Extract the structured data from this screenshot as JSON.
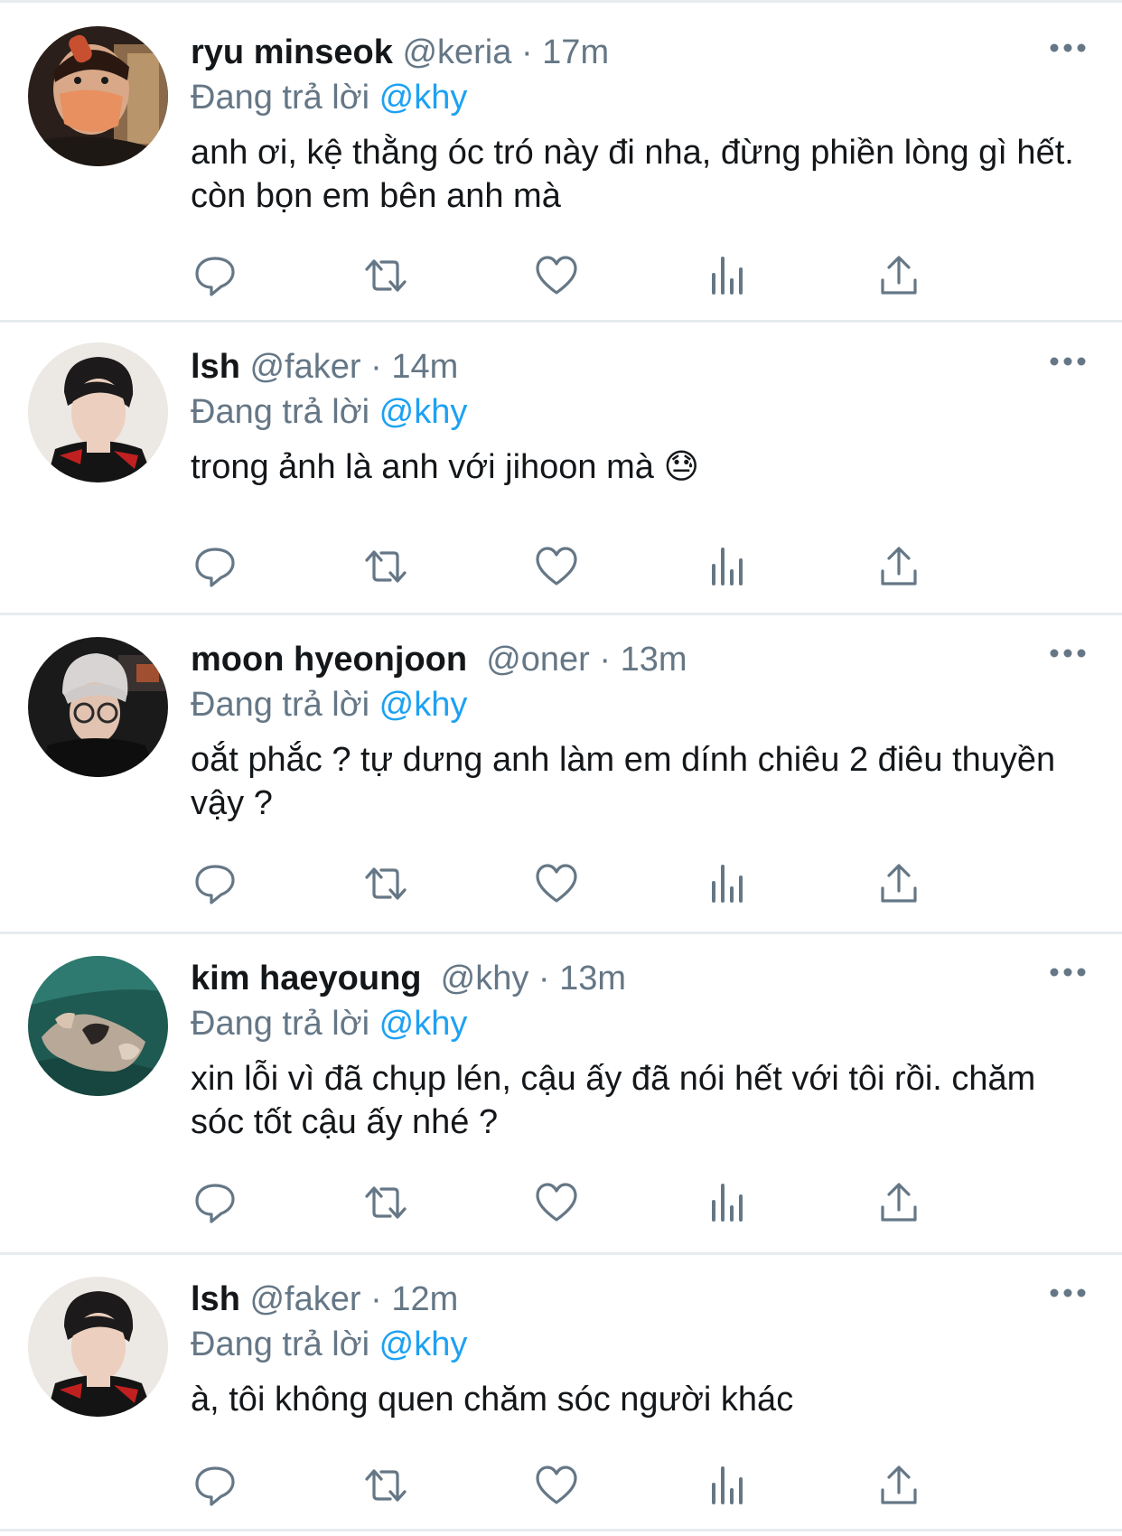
{
  "icons": {
    "more": "more-horizontal-icon",
    "reply": "reply-icon",
    "retweet": "retweet-icon",
    "like": "heart-icon",
    "views": "views-icon",
    "share": "share-icon"
  },
  "colors": {
    "text": "#14171a",
    "secondary": "#657786",
    "accent": "#1da1f2",
    "divider": "#e6ecf0"
  },
  "tweets": [
    {
      "name": "ryu minseok",
      "handle": "@keria",
      "separator": "·",
      "time": "17m",
      "reply_prefix": "Đang trả lời",
      "reply_to": "@khy",
      "text": "anh ơi, kệ thằng óc tró này đi nha, đừng phiền lòng gì hết. còn bọn em bên anh mà"
    },
    {
      "name": "lsh",
      "handle": "@faker",
      "separator": "·",
      "time": "14m",
      "reply_prefix": "Đang trả lời",
      "reply_to": "@khy",
      "text": "trong ảnh là anh với jihoon mà 😓"
    },
    {
      "name": "moon hyeonjoon",
      "handle": "@oner",
      "separator": "·",
      "time": "13m",
      "reply_prefix": "Đang trả lời",
      "reply_to": "@khy",
      "text": "oắt phắc ? tự dưng anh làm em dính chiêu 2 điêu thuyền vậy ?"
    },
    {
      "name": "kim haeyoung",
      "handle": "@khy",
      "separator": "·",
      "time": "13m",
      "reply_prefix": "Đang trả lời",
      "reply_to": "@khy",
      "text": "xin lỗi vì đã chụp lén, cậu ấy đã nói hết với tôi rồi. chăm sóc tốt cậu ấy nhé ?"
    },
    {
      "name": "lsh",
      "handle": "@faker",
      "separator": "·",
      "time": "12m",
      "reply_prefix": "Đang trả lời",
      "reply_to": "@khy",
      "text": "à, tôi không quen chăm sóc người khác"
    }
  ]
}
